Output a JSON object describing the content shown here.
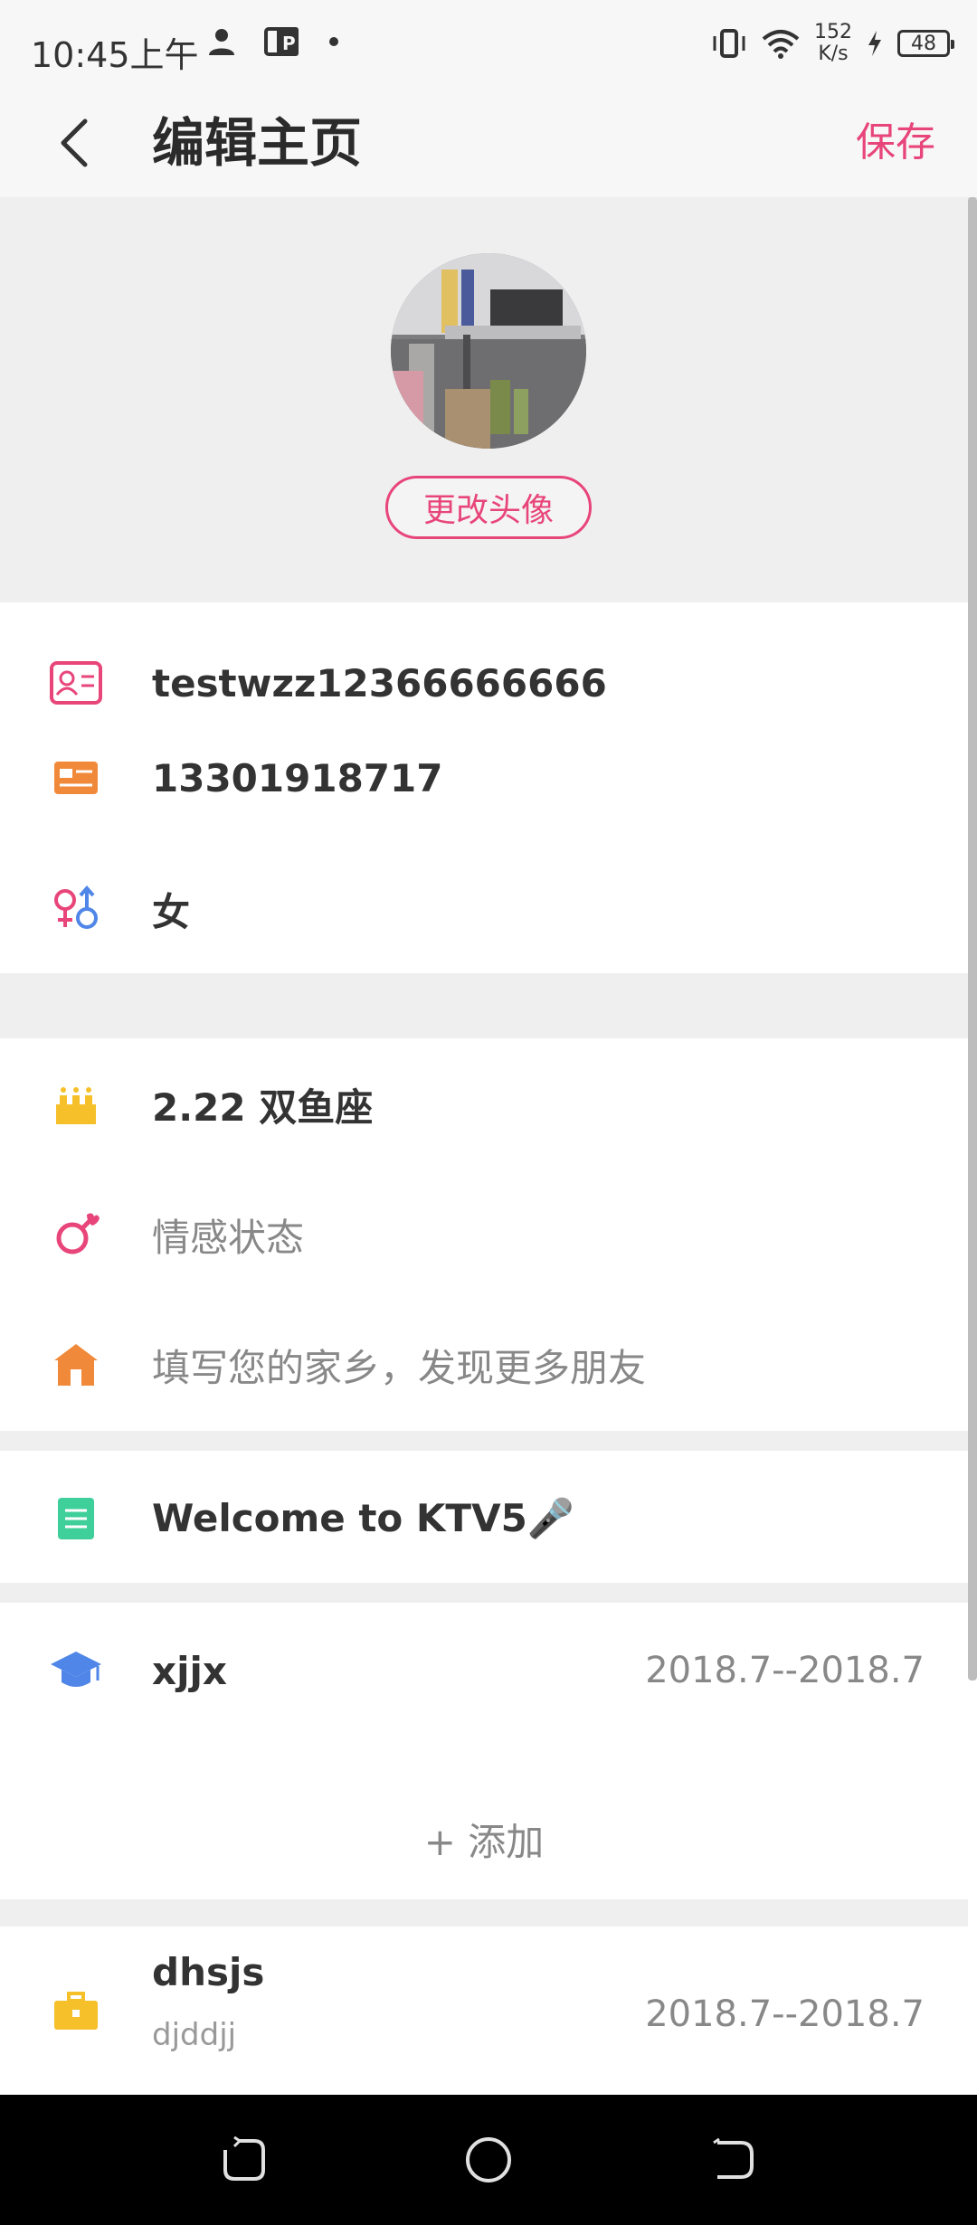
{
  "status_bar": {
    "time": "10:45上午",
    "net_speed_value": "152",
    "net_speed_unit": "K/s",
    "battery": "48"
  },
  "header": {
    "title": "编辑主页",
    "save_label": "保存"
  },
  "avatar": {
    "change_label": "更改头像"
  },
  "profile": {
    "username": "testwzz12366666666",
    "phone": "13301918717",
    "gender": "女",
    "birthday": "2.22 双鱼座",
    "relationship_placeholder": "情感状态",
    "hometown_placeholder": "填写您的家乡，发现更多朋友",
    "signature": "Welcome to KTV5🎤"
  },
  "education": {
    "school": "xjjx",
    "dates": "2018.7--2018.7",
    "add_label": "+ 添加"
  },
  "work": {
    "company": "dhsjs",
    "position": "djddjj",
    "dates": "2018.7--2018.7"
  },
  "colors": {
    "accent": "#e8457a",
    "orange": "#f08a3a",
    "yellow": "#f5c02a",
    "teal": "#3ecf9a",
    "blue": "#4f86e8"
  },
  "icons": {
    "username": "id-card-icon",
    "phone": "card-icon",
    "gender": "gender-icon",
    "birthday": "cake-icon",
    "relationship": "relationship-icon",
    "hometown": "house-icon",
    "signature": "note-icon",
    "education": "graduation-cap-icon",
    "work": "briefcase-icon"
  }
}
